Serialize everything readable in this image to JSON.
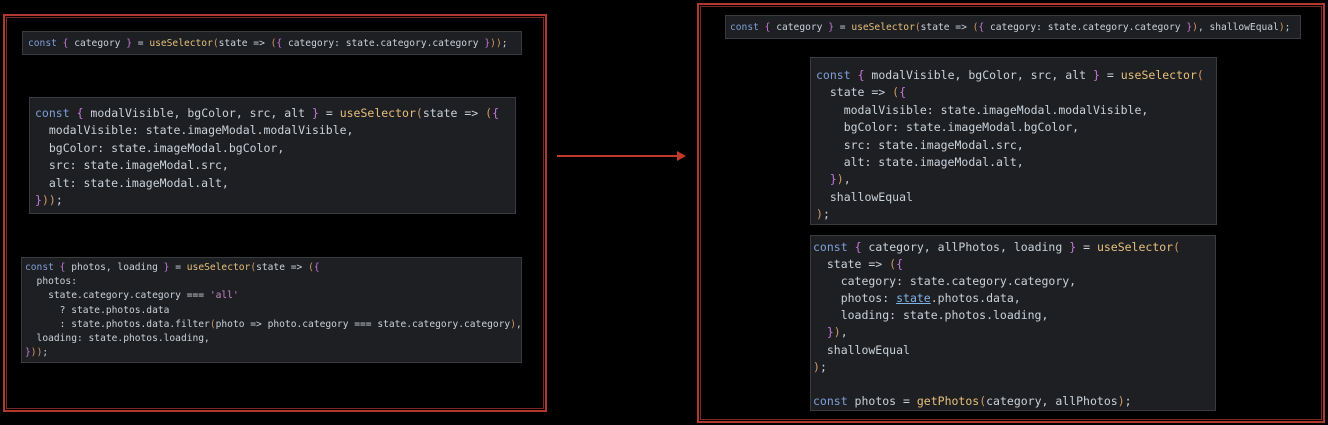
{
  "colors": {
    "frame": "#b0382c",
    "code_bg": "#1e1f22",
    "arrow": "#c0392b"
  },
  "icons": {
    "arrow": "arrow-right-icon"
  },
  "before": {
    "snippet1": [
      "const { category } = useSelector(state => ({ category: state.category.category }));"
    ],
    "snippet2": [
      "const { modalVisible, bgColor, src, alt } = useSelector(state => ({",
      "  modalVisible: state.imageModal.modalVisible,",
      "  bgColor: state.imageModal.bgColor,",
      "  src: state.imageModal.src,",
      "  alt: state.imageModal.alt,",
      "}));"
    ],
    "snippet3": [
      "const { photos, loading } = useSelector(state => ({",
      "  photos:",
      "    state.category.category === 'all'",
      "      ? state.photos.data",
      "      : state.photos.data.filter(photo => photo.category === state.category.category),",
      "  loading: state.photos.loading,",
      "}));"
    ]
  },
  "after": {
    "snippet1": [
      "const { category } = useSelector(state => ({ category: state.category.category }), shallowEqual);"
    ],
    "snippet2": [
      "const { modalVisible, bgColor, src, alt } = useSelector(",
      "  state => ({",
      "    modalVisible: state.imageModal.modalVisible,",
      "    bgColor: state.imageModal.bgColor,",
      "    src: state.imageModal.src,",
      "    alt: state.imageModal.alt,",
      "  }),",
      "  shallowEqual",
      ");"
    ],
    "snippet3": [
      "const { category, allPhotos, loading } = useSelector(",
      "  state => ({",
      "    category: state.category.category,",
      "    photos: state.photos.data,",
      "    loading: state.photos.loading,",
      "  }),",
      "  shallowEqual",
      ");",
      "",
      "const photos = getPhotos(category, allPhotos);"
    ]
  }
}
